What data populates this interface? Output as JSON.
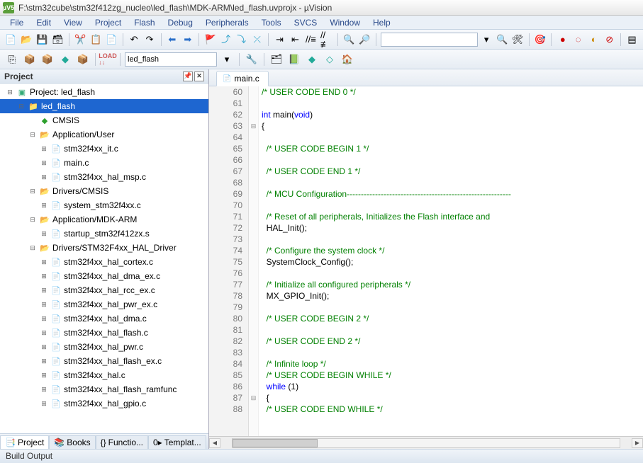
{
  "title": "F:\\stm32cube\\stm32f412zg_nucleo\\led_flash\\MDK-ARM\\led_flash.uvprojx - µVision",
  "app_icon_text": "µV5",
  "menubar": {
    "items": [
      "File",
      "Edit",
      "View",
      "Project",
      "Flash",
      "Debug",
      "Peripherals",
      "Tools",
      "SVCS",
      "Window",
      "Help"
    ]
  },
  "toolbar2": {
    "target_combo": "led_flash"
  },
  "project_pane": {
    "title": "Project",
    "tree": [
      {
        "indent": 0,
        "twisty": "⊟",
        "icon": "proj",
        "label": "Project: led_flash",
        "selected": false
      },
      {
        "indent": 1,
        "twisty": "⊟",
        "icon": "target",
        "label": "led_flash",
        "selected": true
      },
      {
        "indent": 2,
        "twisty": "",
        "icon": "diamond",
        "label": "CMSIS",
        "selected": false
      },
      {
        "indent": 2,
        "twisty": "⊟",
        "icon": "folder",
        "label": "Application/User",
        "selected": false
      },
      {
        "indent": 3,
        "twisty": "⊞",
        "icon": "file",
        "label": "stm32f4xx_it.c",
        "selected": false
      },
      {
        "indent": 3,
        "twisty": "⊞",
        "icon": "file",
        "label": "main.c",
        "selected": false
      },
      {
        "indent": 3,
        "twisty": "⊞",
        "icon": "file",
        "label": "stm32f4xx_hal_msp.c",
        "selected": false
      },
      {
        "indent": 2,
        "twisty": "⊟",
        "icon": "folder",
        "label": "Drivers/CMSIS",
        "selected": false
      },
      {
        "indent": 3,
        "twisty": "⊞",
        "icon": "file",
        "label": "system_stm32f4xx.c",
        "selected": false
      },
      {
        "indent": 2,
        "twisty": "⊟",
        "icon": "folder",
        "label": "Application/MDK-ARM",
        "selected": false
      },
      {
        "indent": 3,
        "twisty": "⊞",
        "icon": "file",
        "label": "startup_stm32f412zx.s",
        "selected": false
      },
      {
        "indent": 2,
        "twisty": "⊟",
        "icon": "folder",
        "label": "Drivers/STM32F4xx_HAL_Driver",
        "selected": false
      },
      {
        "indent": 3,
        "twisty": "⊞",
        "icon": "file",
        "label": "stm32f4xx_hal_cortex.c",
        "selected": false
      },
      {
        "indent": 3,
        "twisty": "⊞",
        "icon": "file",
        "label": "stm32f4xx_hal_dma_ex.c",
        "selected": false
      },
      {
        "indent": 3,
        "twisty": "⊞",
        "icon": "file",
        "label": "stm32f4xx_hal_rcc_ex.c",
        "selected": false
      },
      {
        "indent": 3,
        "twisty": "⊞",
        "icon": "file",
        "label": "stm32f4xx_hal_pwr_ex.c",
        "selected": false
      },
      {
        "indent": 3,
        "twisty": "⊞",
        "icon": "file",
        "label": "stm32f4xx_hal_dma.c",
        "selected": false
      },
      {
        "indent": 3,
        "twisty": "⊞",
        "icon": "file",
        "label": "stm32f4xx_hal_flash.c",
        "selected": false
      },
      {
        "indent": 3,
        "twisty": "⊞",
        "icon": "file",
        "label": "stm32f4xx_hal_pwr.c",
        "selected": false
      },
      {
        "indent": 3,
        "twisty": "⊞",
        "icon": "file",
        "label": "stm32f4xx_hal_flash_ex.c",
        "selected": false
      },
      {
        "indent": 3,
        "twisty": "⊞",
        "icon": "file",
        "label": "stm32f4xx_hal.c",
        "selected": false
      },
      {
        "indent": 3,
        "twisty": "⊞",
        "icon": "file",
        "label": "stm32f4xx_hal_flash_ramfunc",
        "selected": false
      },
      {
        "indent": 3,
        "twisty": "⊞",
        "icon": "file",
        "label": "stm32f4xx_hal_gpio.c",
        "selected": false
      }
    ],
    "tabs": [
      "Project",
      "Books",
      "Functio...",
      "Templat..."
    ],
    "tab_prefixes": [
      "📑",
      "📚",
      "{}",
      "0▸"
    ]
  },
  "editor": {
    "tab_label": "main.c",
    "lines": [
      {
        "n": 60,
        "fold": "",
        "html": "<span class='c-comment'>/* USER CODE END 0 */</span>"
      },
      {
        "n": 61,
        "fold": "",
        "html": ""
      },
      {
        "n": 62,
        "fold": "",
        "html": "<span class='c-type'>int</span> <span class='c-func'>main</span><span class='c-paren'>(</span><span class='c-void'>void</span><span class='c-paren'>)</span>"
      },
      {
        "n": 63,
        "fold": "⊟",
        "html": "<span class='c-plain'>{</span>"
      },
      {
        "n": 64,
        "fold": "",
        "html": ""
      },
      {
        "n": 65,
        "fold": "",
        "html": "  <span class='c-comment'>/* USER CODE BEGIN 1 */</span>"
      },
      {
        "n": 66,
        "fold": "",
        "html": ""
      },
      {
        "n": 67,
        "fold": "",
        "html": "  <span class='c-comment'>/* USER CODE END 1 */</span>"
      },
      {
        "n": 68,
        "fold": "",
        "html": ""
      },
      {
        "n": 69,
        "fold": "",
        "html": "  <span class='c-comment'>/* MCU Configuration----------------------------------------------------------</span>"
      },
      {
        "n": 70,
        "fold": "",
        "html": ""
      },
      {
        "n": 71,
        "fold": "",
        "html": "  <span class='c-comment'>/* Reset of all peripherals, Initializes the Flash interface and </span>"
      },
      {
        "n": 72,
        "fold": "",
        "html": "  <span class='c-plain'>HAL_Init();</span>"
      },
      {
        "n": 73,
        "fold": "",
        "html": ""
      },
      {
        "n": 74,
        "fold": "",
        "html": "  <span class='c-comment'>/* Configure the system clock */</span>"
      },
      {
        "n": 75,
        "fold": "",
        "html": "  <span class='c-plain'>SystemClock_Config();</span>"
      },
      {
        "n": 76,
        "fold": "",
        "html": ""
      },
      {
        "n": 77,
        "fold": "",
        "html": "  <span class='c-comment'>/* Initialize all configured peripherals */</span>"
      },
      {
        "n": 78,
        "fold": "",
        "html": "  <span class='c-plain'>MX_GPIO_Init();</span>"
      },
      {
        "n": 79,
        "fold": "",
        "html": ""
      },
      {
        "n": 80,
        "fold": "",
        "html": "  <span class='c-comment'>/* USER CODE BEGIN 2 */</span>"
      },
      {
        "n": 81,
        "fold": "",
        "html": ""
      },
      {
        "n": 82,
        "fold": "",
        "html": "  <span class='c-comment'>/* USER CODE END 2 */</span>"
      },
      {
        "n": 83,
        "fold": "",
        "html": ""
      },
      {
        "n": 84,
        "fold": "",
        "html": "  <span class='c-comment'>/* Infinite loop */</span>"
      },
      {
        "n": 85,
        "fold": "",
        "html": "  <span class='c-comment'>/* USER CODE BEGIN WHILE */</span>"
      },
      {
        "n": 86,
        "fold": "",
        "html": "  <span class='c-keyword'>while</span> <span class='c-paren'>(</span><span class='c-plain'>1</span><span class='c-paren'>)</span>"
      },
      {
        "n": 87,
        "fold": "⊟",
        "html": "  <span class='c-plain'>{</span>"
      },
      {
        "n": 88,
        "fold": "",
        "html": "  <span class='c-comment'>/* USER CODE END WHILE */</span>"
      }
    ]
  },
  "status_bar": {
    "text": "Build Output"
  }
}
